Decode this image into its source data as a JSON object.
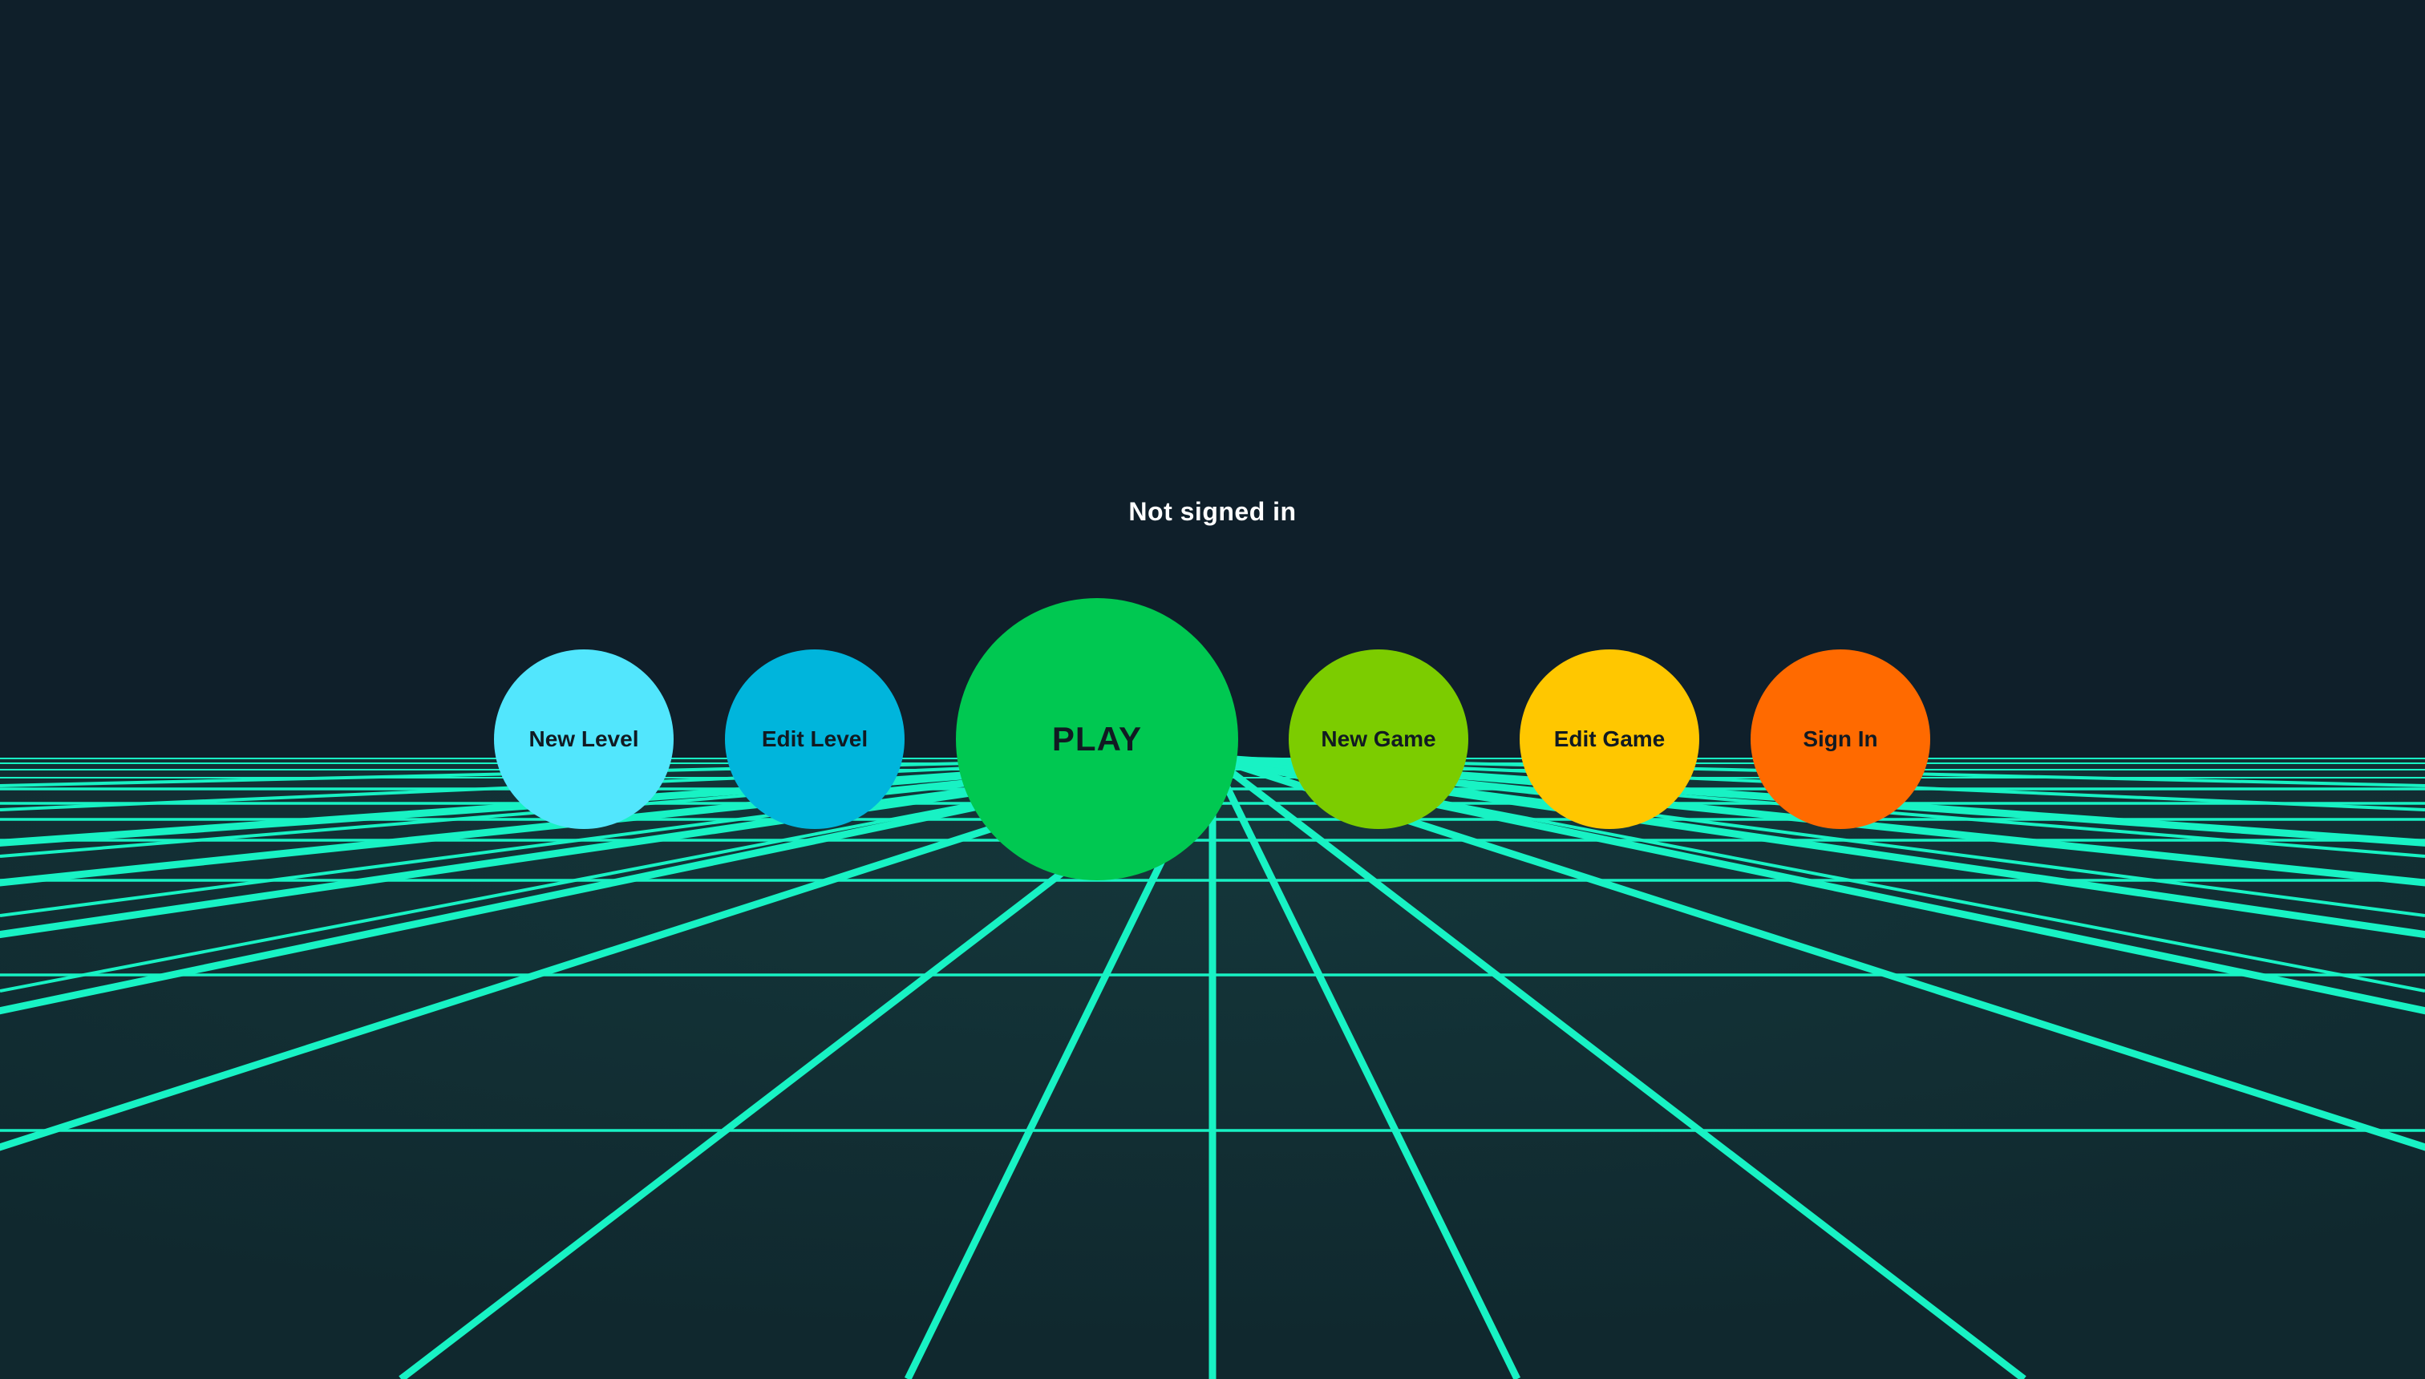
{
  "status": {
    "text": "Not signed in"
  },
  "grid": {
    "line_color": "#18f2c4",
    "floor_color": "#10282e"
  },
  "buttons": {
    "new_level": {
      "label": "New Level",
      "color": "#52e6fd"
    },
    "edit_level": {
      "label": "Edit Level",
      "color": "#00b5dc"
    },
    "play": {
      "label": "PLAY",
      "color": "#00c851"
    },
    "new_game": {
      "label": "New Game",
      "color": "#7ccc00"
    },
    "edit_game": {
      "label": "Edit Game",
      "color": "#ffc700"
    },
    "sign_in": {
      "label": "Sign In",
      "color": "#ff6a00"
    }
  }
}
